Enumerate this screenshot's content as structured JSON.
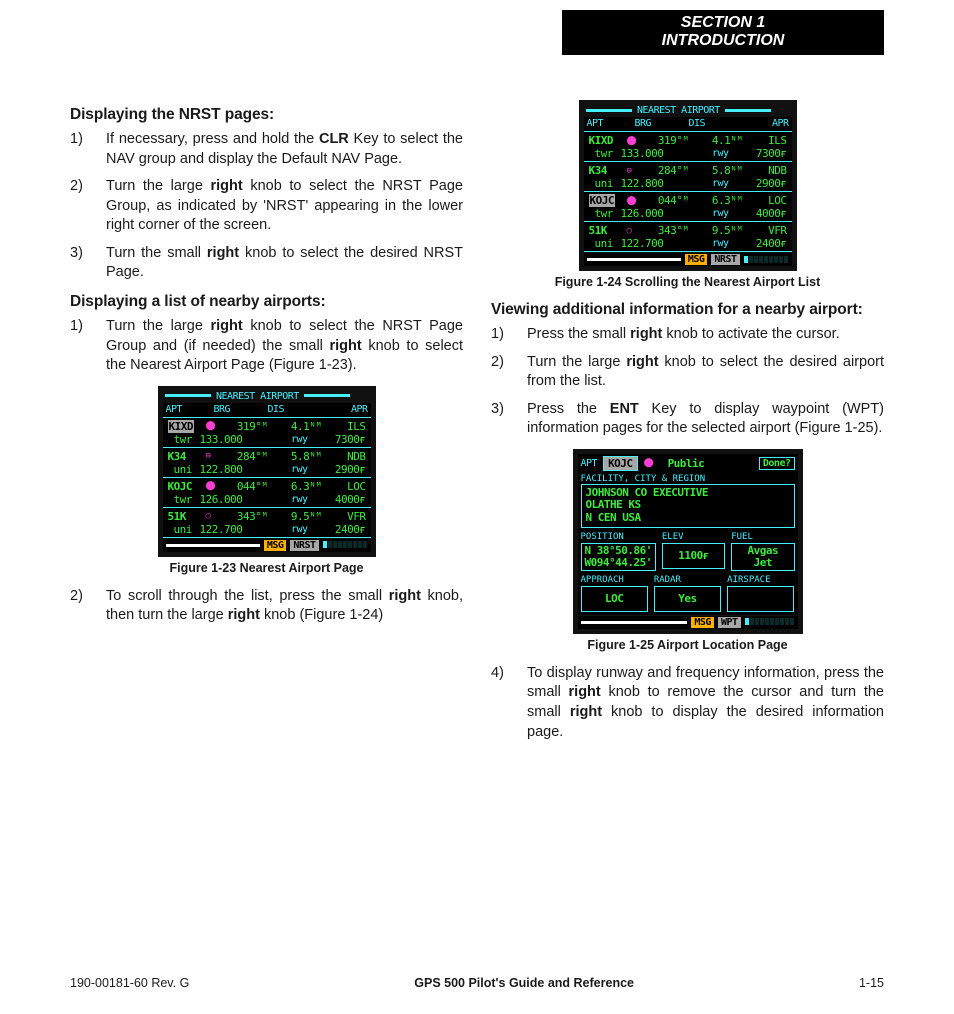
{
  "section": {
    "line1": "SECTION 1",
    "line2": "INTRODUCTION"
  },
  "left": {
    "h1": "Displaying the NRST pages:",
    "p1": [
      {
        "n": "1)",
        "pre": "If necessary, press and hold the ",
        "bold": "CLR",
        "post": " Key to select the NAV group and display the Default NAV Page."
      },
      {
        "n": "2)",
        "pre": "Turn the large ",
        "bold": "right",
        "post": " knob to select the NRST Page Group, as indicated by 'NRST' appearing in the lower right corner of the screen."
      },
      {
        "n": "3)",
        "pre": "Turn the small ",
        "bold": "right",
        "post": " knob to select the desired NRST Page."
      }
    ],
    "h2": "Displaying a list of nearby airports:",
    "p2a": {
      "n": "1)",
      "pre": "Turn the large ",
      "b1": "right",
      "mid": " knob to select the NRST Page Group and (if needed) the small ",
      "b2": "right",
      "post": " knob to select the Nearest Airport Page (Figure 1-23)."
    },
    "fig23cap": "Figure 1-23  Nearest Airport Page",
    "p2b": {
      "n": "2)",
      "pre": "To scroll through the list, press the small ",
      "b1": "right",
      "mid": " knob, then turn the large ",
      "b2": "right",
      "post": " knob (Figure 1-24)"
    }
  },
  "right": {
    "fig24cap": "Figure 1-24  Scrolling the Nearest Airport List",
    "h3": "Viewing additional information for a nearby airport:",
    "p3": [
      {
        "n": "1)",
        "pre": "Press the small ",
        "bold": "right",
        "post": " knob to activate the cursor."
      },
      {
        "n": "2)",
        "pre": "Turn the large ",
        "bold": "right",
        "post": " knob to select the desired airport from the list."
      },
      {
        "n": "3)",
        "pre": "Press the ",
        "bold": "ENT",
        "post": " Key to display waypoint (WPT) information pages for the selected airport (Figure 1-25)."
      }
    ],
    "fig25cap": "Figure 1-25  Airport Location Page",
    "p4": {
      "n": "4)",
      "pre": "To display runway and frequency information, press the small ",
      "b1": "right",
      "mid": " knob to remove the cursor and turn the small ",
      "b2": "right",
      "post": " knob to display the desired information page."
    }
  },
  "gpsList": {
    "title": "NEAREST AIRPORT",
    "headers": [
      "APT",
      "BRG",
      "DIS",
      "APR"
    ],
    "rows": [
      {
        "id": "KIXD",
        "sym": "⬤",
        "brg": "319°ᴹ",
        "dis": "4.1ᴺᴹ",
        "apr": "ILS",
        "fqt": "twr",
        "fqv": "133.000",
        "rwy": "rwy",
        "rwv": "7300ғ"
      },
      {
        "id": "K34",
        "sym": "⊖",
        "brg": "284°ᴹ",
        "dis": "5.8ᴺᴹ",
        "apr": "NDB",
        "fqt": "uni",
        "fqv": "122.800",
        "rwy": "rwy",
        "rwv": "2900ғ"
      },
      {
        "id": "KOJC",
        "sym": "⬤",
        "brg": "044°ᴹ",
        "dis": "6.3ᴺᴹ",
        "apr": "LOC",
        "fqt": "twr",
        "fqv": "126.000",
        "rwy": "rwy",
        "rwv": "4000ғ"
      },
      {
        "id": "51K",
        "sym": "○",
        "brg": "343°ᴹ",
        "dis": "9.5ᴺᴹ",
        "apr": "VFR",
        "fqt": "uni",
        "fqv": "122.700",
        "rwy": "rwy",
        "rwv": "2400ғ"
      }
    ],
    "footer": {
      "msg": "MSG",
      "grp_nrst": "NRST",
      "grp_wpt": "WPT"
    },
    "highlightRow24": 2
  },
  "gpsApt": {
    "tag": "APT",
    "id": "KOJC",
    "sym": "⬤",
    "type": "Public",
    "done": "Done?",
    "sectLbl": "FACILITY, CITY & REGION",
    "facility": [
      "JOHNSON CO EXECUTIVE",
      "OLATHE KS",
      "N CEN USA"
    ],
    "posLbl": "POSITION",
    "elevLbl": "ELEV",
    "fuelLbl": "FUEL",
    "position": [
      "N 38°50.86'",
      "W094°44.25'"
    ],
    "elev": "1100ғ",
    "fuel": [
      "Avgas",
      "Jet"
    ],
    "apprLbl": "APPROACH",
    "radarLbl": "RADAR",
    "airspLbl": "AIRSPACE",
    "approach": "LOC",
    "radar": "Yes",
    "airspace": ""
  },
  "footer": {
    "left": "190-00181-60  Rev. G",
    "center": "GPS 500 Pilot's Guide and Reference",
    "right": "1-15"
  }
}
